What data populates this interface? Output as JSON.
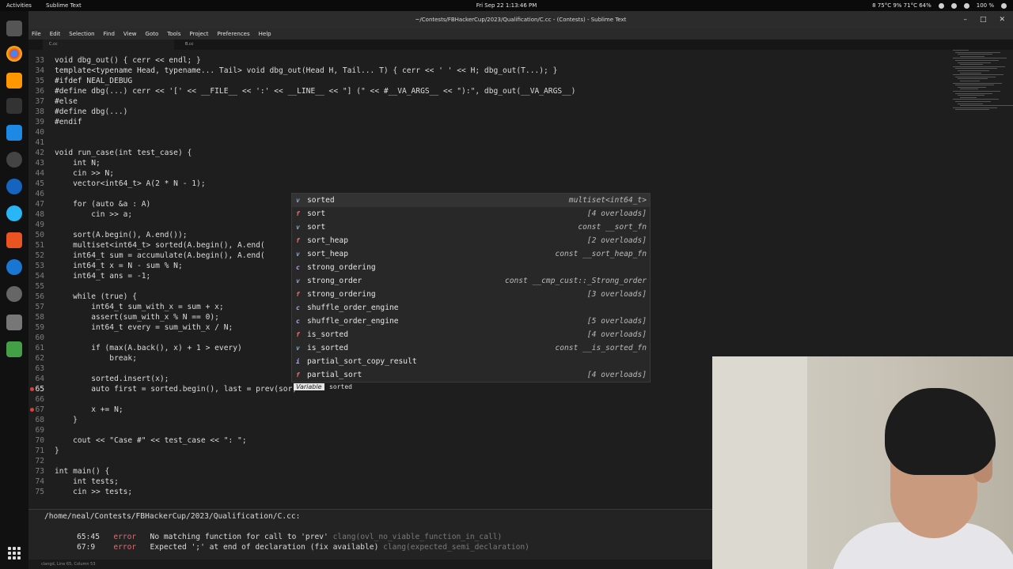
{
  "topbar": {
    "activities": "Activities",
    "app_name": "Sublime Text",
    "clock": "Fri Sep 22  1:13:46 PM",
    "tray": "8 75°C 9% 71°C 64%",
    "battery": "100 %"
  },
  "window": {
    "title": "~/Contests/FBHackerCup/2023/Qualification/C.cc - (Contests) - Sublime Text"
  },
  "menu": [
    "File",
    "Edit",
    "Selection",
    "Find",
    "View",
    "Goto",
    "Tools",
    "Project",
    "Preferences",
    "Help"
  ],
  "tabs": [
    "C.cc",
    "B.cc"
  ],
  "editor": {
    "lines": [
      {
        "n": "33",
        "t": "void dbg_out() { cerr << endl; }"
      },
      {
        "n": "34",
        "t": "template<typename Head, typename... Tail> void dbg_out(Head H, Tail... T) { cerr << ' ' << H; dbg_out(T...); }"
      },
      {
        "n": "35",
        "t": "#ifdef NEAL_DEBUG"
      },
      {
        "n": "36",
        "t": "#define dbg(...) cerr << '[' << __FILE__ << ':' << __LINE__ << \"] (\" << #__VA_ARGS__ << \"):\", dbg_out(__VA_ARGS__)"
      },
      {
        "n": "37",
        "t": "#else"
      },
      {
        "n": "38",
        "t": "#define dbg(...)"
      },
      {
        "n": "39",
        "t": "#endif"
      },
      {
        "n": "40",
        "t": ""
      },
      {
        "n": "41",
        "t": ""
      },
      {
        "n": "42",
        "t": "void run_case(int test_case) {"
      },
      {
        "n": "43",
        "t": "    int N;"
      },
      {
        "n": "44",
        "t": "    cin >> N;"
      },
      {
        "n": "45",
        "t": "    vector<int64_t> A(2 * N - 1);"
      },
      {
        "n": "46",
        "t": ""
      },
      {
        "n": "47",
        "t": "    for (auto &a : A)"
      },
      {
        "n": "48",
        "t": "        cin >> a;"
      },
      {
        "n": "49",
        "t": ""
      },
      {
        "n": "50",
        "t": "    sort(A.begin(), A.end());"
      },
      {
        "n": "51",
        "t": "    multiset<int64_t> sorted(A.begin(), A.end("
      },
      {
        "n": "52",
        "t": "    int64_t sum = accumulate(A.begin(), A.end("
      },
      {
        "n": "53",
        "t": "    int64_t x = N - sum % N;"
      },
      {
        "n": "54",
        "t": "    int64_t ans = -1;"
      },
      {
        "n": "55",
        "t": ""
      },
      {
        "n": "56",
        "t": "    while (true) {"
      },
      {
        "n": "57",
        "t": "        int64_t sum_with_x = sum + x;"
      },
      {
        "n": "58",
        "t": "        assert(sum_with_x % N == 0);"
      },
      {
        "n": "59",
        "t": "        int64_t every = sum_with_x / N;"
      },
      {
        "n": "60",
        "t": ""
      },
      {
        "n": "61",
        "t": "        if (max(A.back(), x) + 1 > every)"
      },
      {
        "n": "62",
        "t": "            break;"
      },
      {
        "n": "63",
        "t": ""
      },
      {
        "n": "64",
        "t": "        sorted.insert(x);"
      },
      {
        "n": "65",
        "t": "        auto first = sorted.begin(), last = prev(sor)"
      },
      {
        "n": "66",
        "t": ""
      },
      {
        "n": "67",
        "t": "        x += N;"
      },
      {
        "n": "68",
        "t": "    }"
      },
      {
        "n": "69",
        "t": ""
      },
      {
        "n": "70",
        "t": "    cout << \"Case #\" << test_case << \": \";"
      },
      {
        "n": "71",
        "t": "}"
      },
      {
        "n": "72",
        "t": ""
      },
      {
        "n": "73",
        "t": "int main() {"
      },
      {
        "n": "74",
        "t": "    int tests;"
      },
      {
        "n": "75",
        "t": "    cin >> tests;"
      }
    ]
  },
  "autocomplete": {
    "items": [
      {
        "kind": "v",
        "label": "sorted",
        "detail": "multiset<int64_t>"
      },
      {
        "kind": "f",
        "label": "sort",
        "detail": "[4 overloads]"
      },
      {
        "kind": "v",
        "label": "sort",
        "detail": "const __sort_fn"
      },
      {
        "kind": "f",
        "label": "sort_heap",
        "detail": "[2 overloads]"
      },
      {
        "kind": "v",
        "label": "sort_heap",
        "detail": "const __sort_heap_fn"
      },
      {
        "kind": "c",
        "label": "strong_ordering",
        "detail": ""
      },
      {
        "kind": "v",
        "label": "strong_order",
        "detail": "const __cmp_cust::_Strong_order"
      },
      {
        "kind": "f",
        "label": "strong_ordering",
        "detail": "[3 overloads]"
      },
      {
        "kind": "c",
        "label": "shuffle_order_engine",
        "detail": ""
      },
      {
        "kind": "c",
        "label": "shuffle_order_engine",
        "detail": "[5 overloads]"
      },
      {
        "kind": "f",
        "label": "is_sorted",
        "detail": "[4 overloads]"
      },
      {
        "kind": "v",
        "label": "is_sorted",
        "detail": "const __is_sorted_fn"
      },
      {
        "kind": "i",
        "label": "partial_sort_copy_result",
        "detail": ""
      },
      {
        "kind": "f",
        "label": "partial_sort",
        "detail": "[4 overloads]"
      }
    ],
    "footer_kind": "Variable",
    "footer_name": "sorted"
  },
  "diagnostics": {
    "file": "/home/neal/Contests/FBHackerCup/2023/Qualification/C.cc:",
    "items": [
      {
        "loc": "65:45",
        "severity": "error",
        "message": "No matching function for call to 'prev'",
        "code": "clang(ovl_no_viable_function_in_call)"
      },
      {
        "loc": "67:9",
        "severity": "error",
        "message": "Expected ';' at end of declaration (fix available)",
        "code": "clang(expected_semi_declaration)"
      }
    ]
  },
  "status": {
    "text": "clangd, Line 65, Column 53"
  },
  "colors": {
    "kind_v": "#7aa6da",
    "kind_f": "#e06c75",
    "kind_c": "#c3a6ff",
    "kind_i": "#c3a6ff",
    "error": "#e06c75"
  }
}
